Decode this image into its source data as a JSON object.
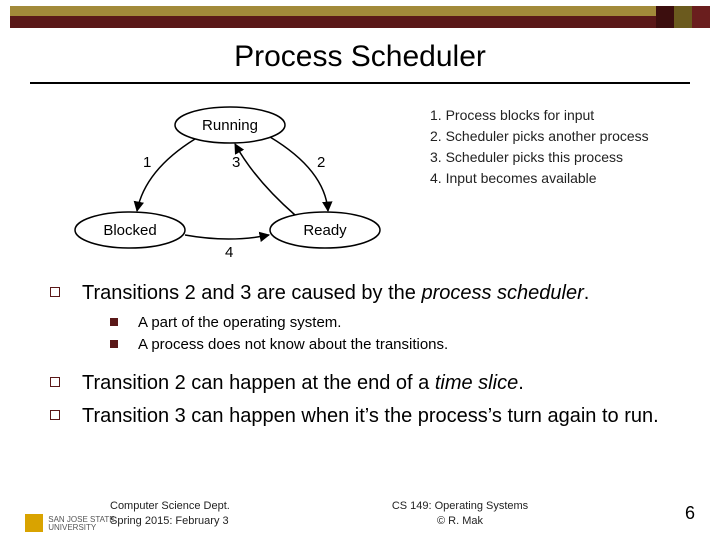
{
  "title": "Process Scheduler",
  "diagram": {
    "states": {
      "running": "Running",
      "blocked": "Blocked",
      "ready": "Ready"
    },
    "edge_labels": {
      "e1": "1",
      "e2": "2",
      "e3": "3",
      "e4": "4"
    },
    "legend": {
      "l1": "1. Process blocks for input",
      "l2": "2. Scheduler picks another process",
      "l3": "3. Scheduler picks this process",
      "l4": "4. Input becomes available"
    }
  },
  "bullets": {
    "b1": "Transitions 2 and 3 are caused by the ",
    "b1_em": "process scheduler",
    "b1_tail": ".",
    "sub1": "A part of the operating system.",
    "sub2": "A process does not know about the transitions.",
    "b2": "Transition 2 can happen at the end of a ",
    "b2_em": "time slice",
    "b2_tail": ".",
    "b3": "Transition 3 can happen when it’s the process’s turn again to run."
  },
  "footer": {
    "logo_text": "SAN JOSE STATE\nUNIVERSITY",
    "left_l1": "Computer Science Dept.",
    "left_l2": "Spring 2015: February 3",
    "center_l1": "CS 149: Operating Systems",
    "center_l2": "© R. Mak",
    "page": "6"
  }
}
